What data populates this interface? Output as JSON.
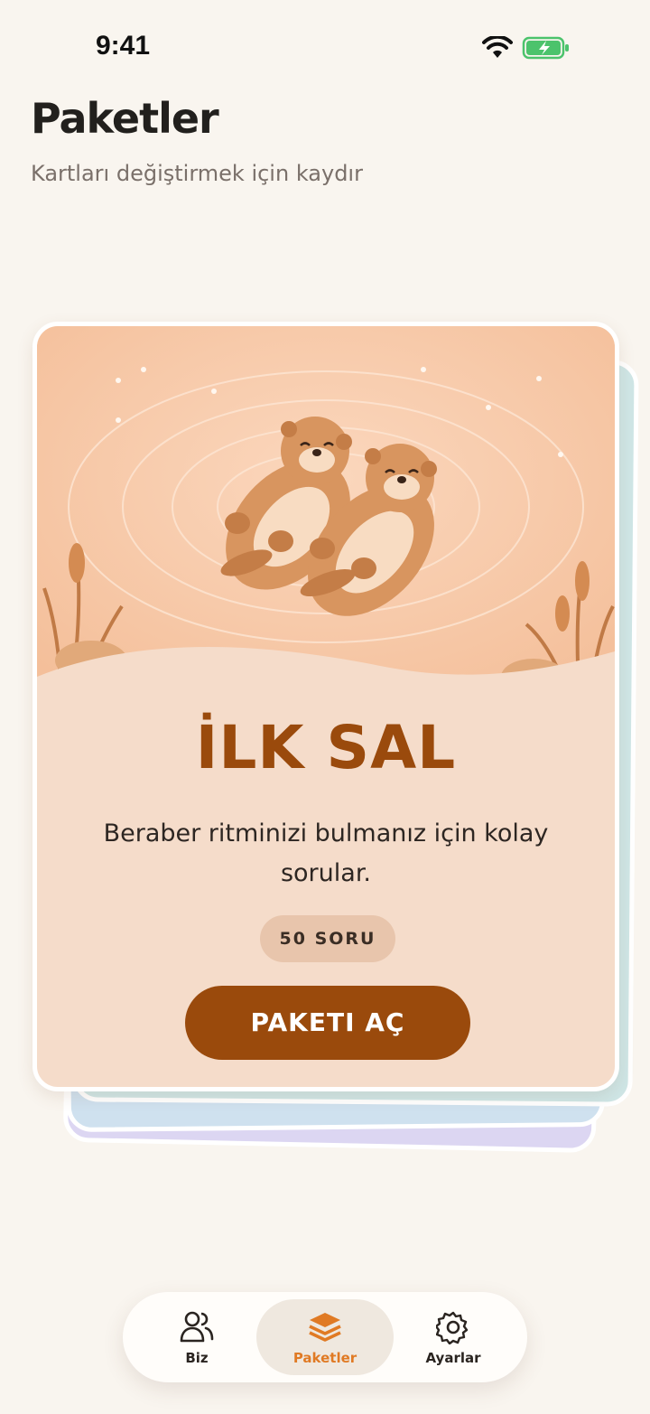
{
  "status": {
    "time": "9:41"
  },
  "header": {
    "title": "Paketler",
    "subtitle": "Kartları değiştirmek için kaydır"
  },
  "card": {
    "title": "İLK SAL",
    "description": "Beraber ritminizi bulmanız için kolay sorular.",
    "badge": "50 SORU",
    "button_label": "PAKETI AÇ",
    "illustration": "two-otters-floating-icon"
  },
  "tabs": [
    {
      "label": "Biz",
      "icon": "people-icon",
      "active": false
    },
    {
      "label": "Paketler",
      "icon": "layers-icon",
      "active": true
    },
    {
      "label": "Ayarlar",
      "icon": "gear-icon",
      "active": false
    }
  ],
  "colors": {
    "background": "#f9f5ef",
    "accent": "#9a4a0c",
    "active_tab": "#e07a24",
    "card": "#f5dcca"
  }
}
